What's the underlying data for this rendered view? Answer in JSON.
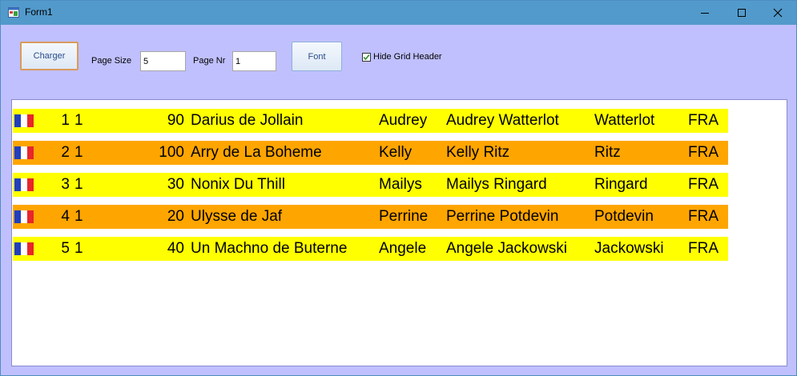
{
  "window": {
    "title": "Form1"
  },
  "toolbar": {
    "charger_label": "Charger",
    "page_size_label": "Page Size",
    "page_size_value": "5",
    "page_nr_label": "Page Nr",
    "page_nr_value": "1",
    "font_label": "Font",
    "hide_header_label": "Hide Grid Header",
    "hide_header_checked": true
  },
  "grid": {
    "rows": [
      {
        "num": "1",
        "col2": "1",
        "value": "90",
        "horse": "Darius de Jollain",
        "first": "Audrey",
        "full": "Audrey Watterlot",
        "last": "Watterlot",
        "country": "FRA",
        "color": "#ffff00"
      },
      {
        "num": "2",
        "col2": "1",
        "value": "100",
        "horse": "Arry de La Boheme",
        "first": "Kelly",
        "full": "Kelly Ritz",
        "last": "Ritz",
        "country": "FRA",
        "color": "#ffa500"
      },
      {
        "num": "3",
        "col2": "1",
        "value": "30",
        "horse": "Nonix Du Thill",
        "first": "Mailys",
        "full": "Mailys Ringard",
        "last": "Ringard",
        "country": "FRA",
        "color": "#ffff00"
      },
      {
        "num": "4",
        "col2": "1",
        "value": "20",
        "horse": "Ulysse de Jaf",
        "first": "Perrine",
        "full": "Perrine Potdevin",
        "last": "Potdevin",
        "country": "FRA",
        "color": "#ffa500"
      },
      {
        "num": "5",
        "col2": "1",
        "value": "40",
        "horse": "Un Machno de Buterne",
        "first": "Angele",
        "full": "Angele Jackowski",
        "last": "Jackowski",
        "country": "FRA",
        "color": "#ffff00"
      }
    ]
  },
  "icons": {
    "app": "app-window-icon",
    "flag": "france-flag-icon",
    "check": "checkmark-icon"
  },
  "colors": {
    "window_bg": "#c0c0ff",
    "titlebar": "#529acb",
    "flag_blue": "#1f3fbf",
    "flag_white": "#ffffff",
    "flag_red": "#e8262b"
  }
}
